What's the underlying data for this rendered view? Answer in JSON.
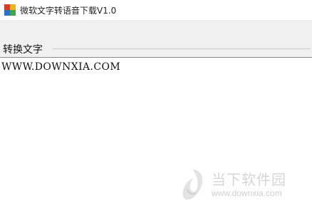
{
  "window": {
    "title": "微软文字转语音下载V1.0",
    "icon": "app-icon"
  },
  "group": {
    "label": "转换文字"
  },
  "text_area": {
    "value": "WWW.DOWNXIA.COM"
  },
  "watermark": {
    "name": "当下软件园",
    "url": "www.downxia.com",
    "icon": "downxia-logo-icon"
  }
}
